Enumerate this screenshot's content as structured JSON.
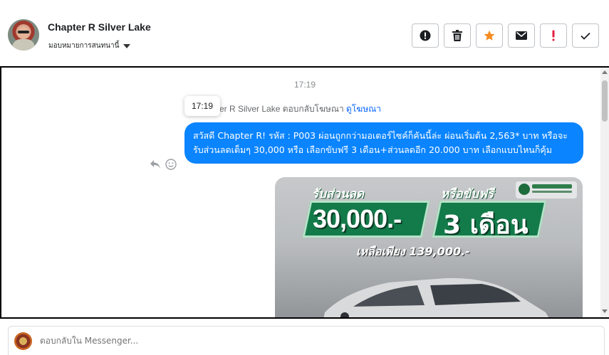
{
  "header": {
    "name": "Chapter R Silver Lake",
    "assign_label": "มอบหมายการสนทนานี้",
    "actions": [
      {
        "icon": "alert-circle-icon",
        "color": "#1c1e21"
      },
      {
        "icon": "trash-icon",
        "color": "#1c1e21"
      },
      {
        "icon": "star-icon",
        "color": "#f58b1f"
      },
      {
        "icon": "envelope-icon",
        "color": "#1c1e21"
      },
      {
        "icon": "exclamation-icon",
        "color": "#e41e3f"
      },
      {
        "icon": "check-icon",
        "color": "#1c1e21"
      }
    ]
  },
  "chat": {
    "timestamp": "17:19",
    "tooltip": "17:19",
    "reply_prefix": "pter R Silver Lake ตอบกลับโฆษณา",
    "reply_link": "ดูโฆษณา",
    "message": "สวัสดี Chapter R! รหัส : P003 ผ่อนถูกกว่ามอเตอร์ไซค์ก็คันนี้ล่ะ ผ่อนเริ่มต้น 2,563* บาท หรือจะรับส่วนลดเต็มๆ 30,000 หรือ เลือกขับฟรี 3 เดือน+ส่วนลดอีก 20.000 บาท เลือกแบบไหนก็คุ้ม",
    "bubble_color": "#0a84ff",
    "ad": {
      "line1": "รับส่วนลด",
      "line1b": "หรือขับฟรี",
      "big1": "30,000.-",
      "big2": "3 เดือน",
      "price": "เหลือเพียง 139,000.-"
    }
  },
  "composer": {
    "placeholder": "ตอบกลับใน Messenger..."
  }
}
